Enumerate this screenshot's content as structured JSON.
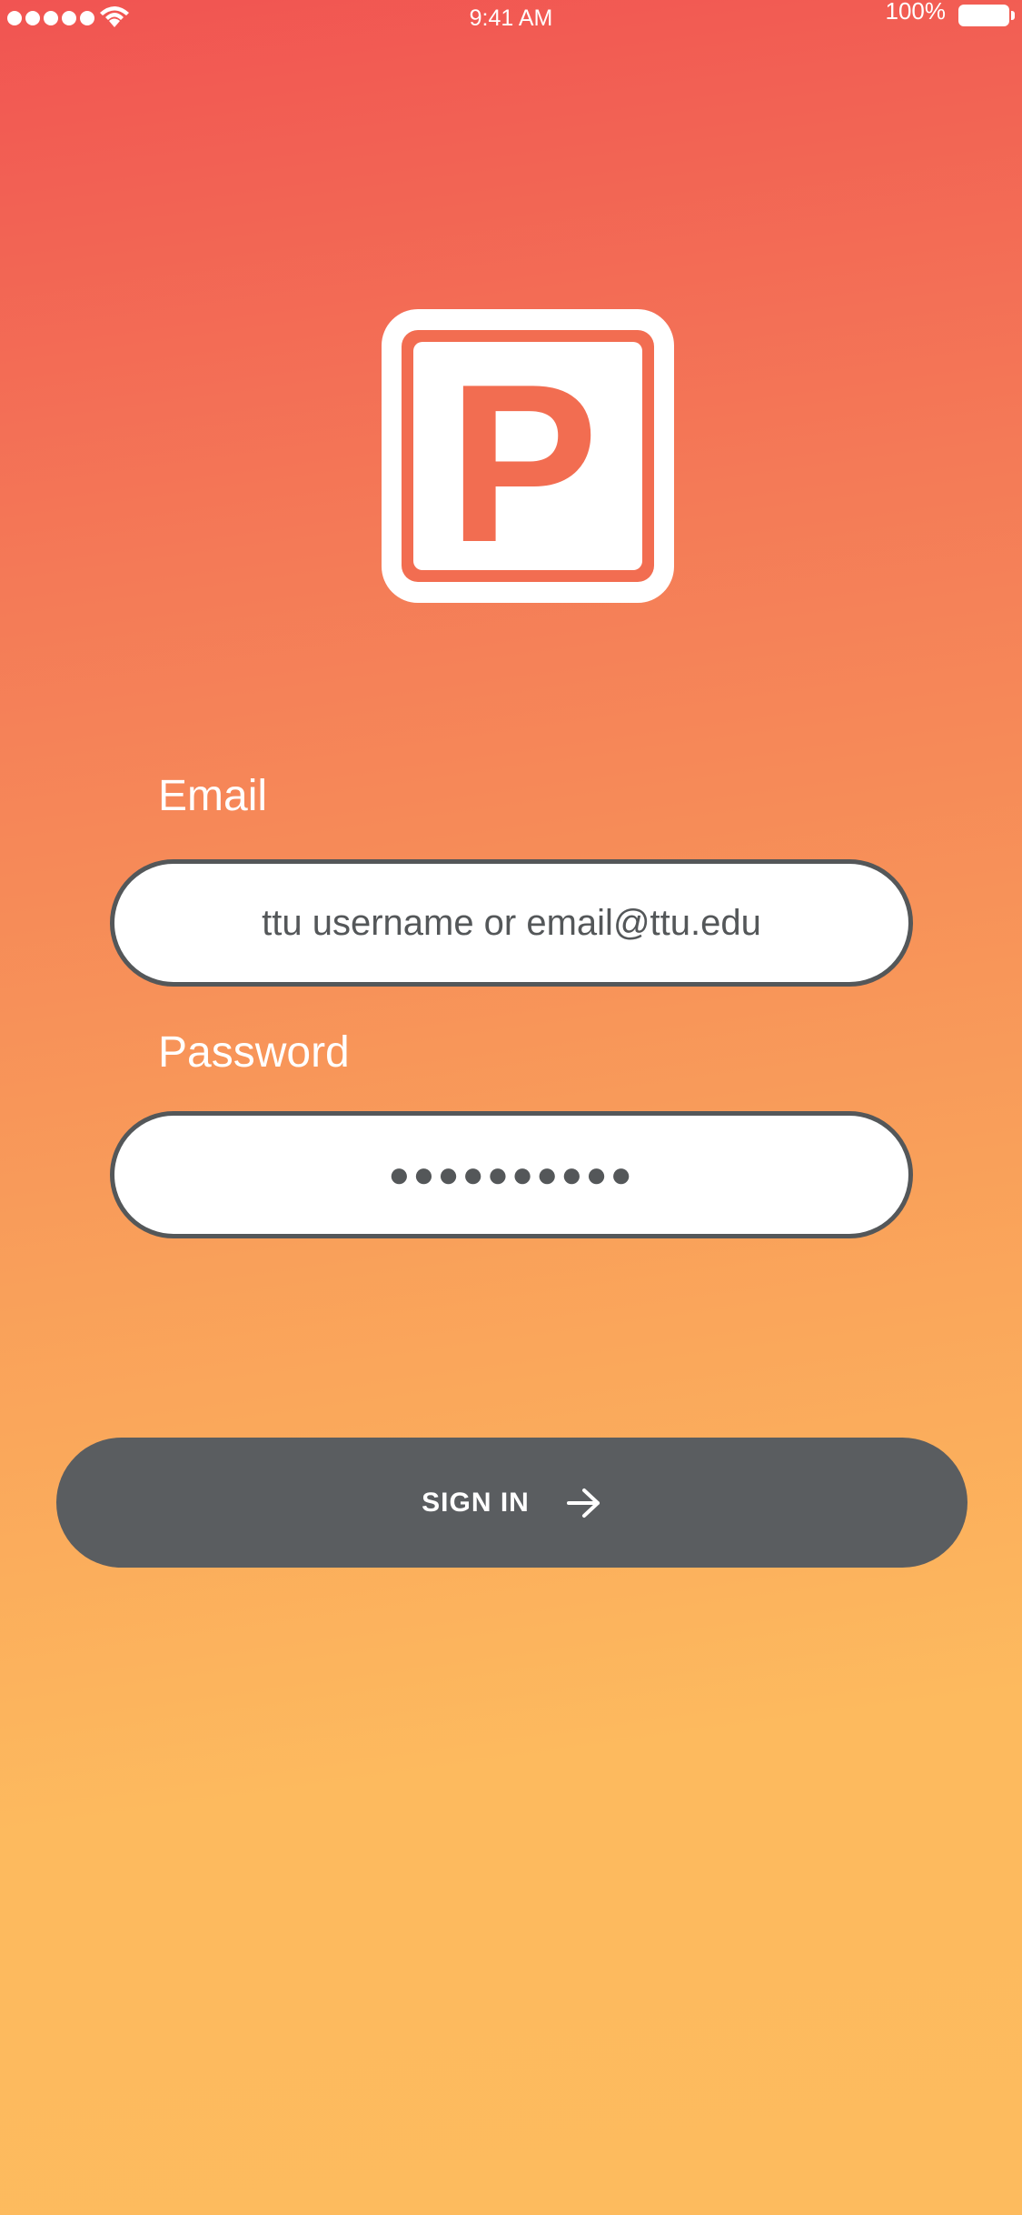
{
  "status_bar": {
    "time": "9:41 AM",
    "battery_percent": "100%",
    "signal_dots": 5,
    "icons": [
      "signal-dots-icon",
      "wifi-icon",
      "battery-icon"
    ]
  },
  "logo": {
    "icon": "parking-p-icon",
    "letter": "P",
    "color": "#f26d51"
  },
  "form": {
    "email": {
      "label": "Email",
      "value": "ttu username or email@ttu.edu"
    },
    "password": {
      "label": "Password",
      "value": "●●●●●●●●●●"
    },
    "sign_in": {
      "label": "SIGN IN",
      "icon": "arrow-right-icon"
    }
  },
  "colors": {
    "gradient_top": "#f15452",
    "gradient_bottom": "#fdbb5e",
    "button": "#5a5d60",
    "field_border": "#545759",
    "text_dark": "#545759"
  }
}
